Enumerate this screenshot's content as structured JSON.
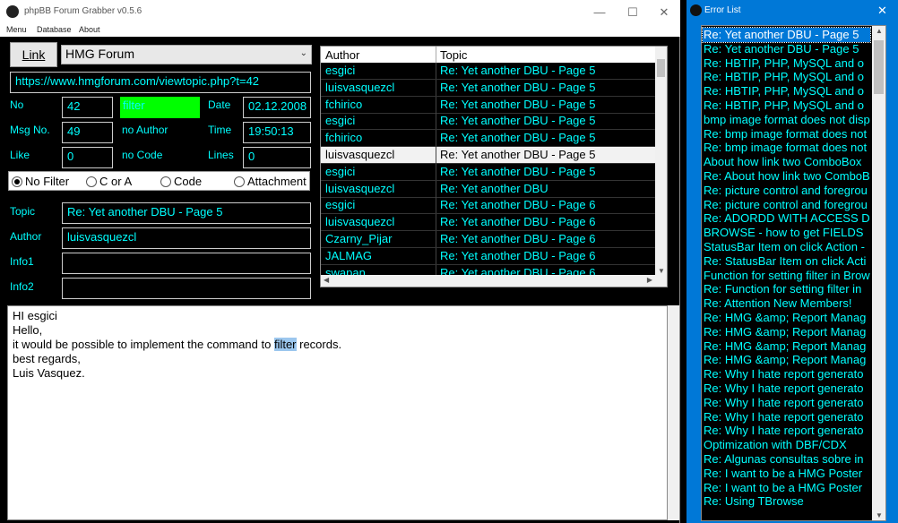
{
  "window": {
    "title": "phpBB Forum Grabber v0.5.6",
    "minimize": "—",
    "maximize": "☐",
    "close": "✕"
  },
  "menu": {
    "items": [
      "Menu",
      "Database",
      "About"
    ]
  },
  "link_button": "Link",
  "forum_select": {
    "value": "HMG Forum"
  },
  "url": "https://www.hmgforum.com/viewtopic.php?t=42",
  "fields": {
    "no_label": "No",
    "no_value": "42",
    "filter_value": "filter",
    "date_label": "Date",
    "date_value": "02.12.2008",
    "msgno_label": "Msg No.",
    "msgno_value": "49",
    "no_author": "no Author",
    "time_label": "Time",
    "time_value": "19:50:13",
    "like_label": "Like",
    "like_value": "0",
    "no_code": "no Code",
    "lines_label": "Lines",
    "lines_value": "0"
  },
  "filters": {
    "no_filter": "No Filter",
    "c_or_a": "C or A",
    "code": "Code",
    "attachment": "Attachment"
  },
  "details": {
    "topic_label": "Topic",
    "topic_value": "Re: Yet another DBU - Page 5",
    "author_label": "Author",
    "author_value": "luisvasquezcl",
    "info1_label": "Info1",
    "info1_value": "",
    "info2_label": "Info2",
    "info2_value": ""
  },
  "grid": {
    "headers": [
      "Author",
      "Topic"
    ],
    "rows": [
      [
        "esgici",
        "Re: Yet another DBU - Page 5"
      ],
      [
        "luisvasquezcl",
        "Re: Yet another DBU - Page 5"
      ],
      [
        "fchirico",
        "Re: Yet another DBU - Page 5"
      ],
      [
        "esgici",
        "Re: Yet another DBU - Page 5"
      ],
      [
        "fchirico",
        "Re: Yet another DBU - Page 5"
      ],
      [
        "luisvasquezcl",
        "Re: Yet another DBU - Page 5"
      ],
      [
        "esgici",
        "Re: Yet another DBU - Page 5"
      ],
      [
        "luisvasquezcl",
        "Re: Yet another DBU"
      ],
      [
        "esgici",
        "Re: Yet another DBU - Page 6"
      ],
      [
        "luisvasquezcl",
        "Re: Yet another DBU - Page 6"
      ],
      [
        "Czarny_Pijar",
        "Re: Yet another DBU - Page 6"
      ],
      [
        "JALMAG",
        "Re: Yet another DBU - Page 6"
      ],
      [
        "swapan",
        "Re: Yet another DBU - Page 6"
      ]
    ]
  },
  "message": {
    "line1": "HI esgici",
    "line2": "Hello,",
    "line3_pre": "it would be possible to implement the command to ",
    "line3_hl": "filter",
    "line3_post": " records.",
    "line4": "best regards,",
    "line5": "Luis Vasquez."
  },
  "error_list": {
    "title": "Error List",
    "items": [
      "Re: Yet another DBU - Page 5",
      "Re: Yet another DBU - Page 5",
      "Re: HBTIP, PHP, MySQL and o",
      "Re: HBTIP, PHP, MySQL and o",
      "Re: HBTIP, PHP, MySQL and o",
      "Re: HBTIP, PHP, MySQL and o",
      "bmp image format does not disp",
      "Re: bmp image format does not",
      "Re: bmp image format does not",
      "About how link two ComboBox",
      "Re: About how link two ComboB",
      "Re: picture control and foregrou",
      "Re: picture control and foregrou",
      "Re: ADORDD WITH ACCESS D",
      "BROWSE - how to get FIELDS",
      "StatusBar Item on click Action -",
      "Re: StatusBar Item on click Acti",
      "Function for setting filter in Brow",
      "Re: Function for setting filter in",
      "Re: Attention New Members!",
      "Re: HMG &amp; Report Manag",
      "Re: HMG &amp; Report Manag",
      "Re: HMG &amp; Report Manag",
      "Re: HMG &amp; Report Manag",
      "Re: Why I hate report generato",
      "Re: Why I hate report generato",
      "Re: Why I hate report generato",
      "Re: Why I hate report generato",
      "Re: Why I hate report generato",
      "Optimization with DBF/CDX",
      "Re: Algunas consultas sobre in",
      "Re: I want to be a HMG Poster",
      "Re: I want to be a HMG Poster",
      "Re: Using TBrowse"
    ]
  },
  "colors": {
    "text": "#00ffff",
    "filter_bg": "#00ff00",
    "accent": "#0078d7"
  }
}
